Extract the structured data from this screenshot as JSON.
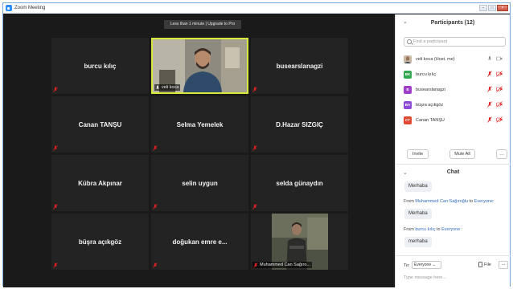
{
  "window": {
    "title": "Zoom Meeting"
  },
  "banner": {
    "text": "Less than 1 minute | Upgrade to Pro"
  },
  "tiles": [
    {
      "name": "burcu kılıç"
    },
    {
      "name": "veli koca",
      "video": true
    },
    {
      "name": "busearslanagzi"
    },
    {
      "name": "Canan TANŞU"
    },
    {
      "name": "Selma Yemelek"
    },
    {
      "name": "D.Hazar SIZGIÇ"
    },
    {
      "name": "Kübra Akpınar"
    },
    {
      "name": "selin uygun"
    },
    {
      "name": "selda günaydın"
    },
    {
      "name": "büşra açıkgöz"
    },
    {
      "name": "doğukan emre e..."
    },
    {
      "name": "Muhammed Can Sağıro...",
      "video": true
    }
  ],
  "participants": {
    "title": "Participants (12)",
    "search_placeholder": "Find a participant",
    "items": [
      {
        "initials": "",
        "name": "veli koca (Host, me)",
        "color": "#8a6d52",
        "photo": true
      },
      {
        "initials": "BK",
        "name": "burcu kılıç",
        "color": "#33a853"
      },
      {
        "initials": "B",
        "name": "busearslanagzi",
        "color": "#9c3fc4"
      },
      {
        "initials": "BA",
        "name": "büşra açıkgöz",
        "color": "#8b4bd6"
      },
      {
        "initials": "CT",
        "name": "Canan TANŞU",
        "color": "#e0482f"
      }
    ],
    "buttons": {
      "invite": "Invite",
      "mute_all": "Mute All",
      "more": "..."
    }
  },
  "chat": {
    "title": "Chat",
    "messages": [
      {
        "from": "",
        "to": "",
        "text": "Merhaba"
      },
      {
        "from": "Muhammed Can Sağıroğlu",
        "to": "Everyone",
        "text": "Merhaba"
      },
      {
        "from": "burcu kılıç",
        "to": "Everyone",
        "text": "merhaba"
      }
    ],
    "from_prefix": "From",
    "to_word": "to",
    "to_label": "To:",
    "to_value": "Everyone",
    "file_label": "File",
    "more": "...",
    "input_placeholder": "Type message here..."
  },
  "colors": {
    "accent": "#2d8cff",
    "active_speaker": "#d7e83a",
    "muted": "#e02020"
  }
}
